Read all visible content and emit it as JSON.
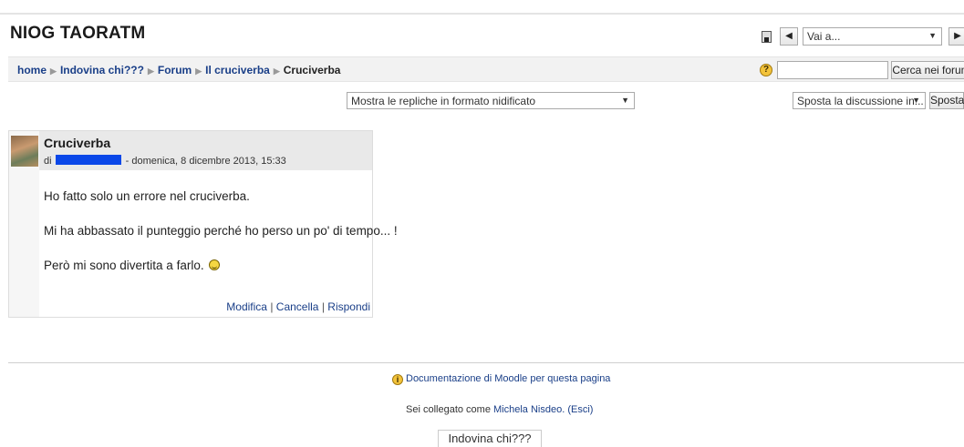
{
  "site": {
    "title": "NIOG TAORATM"
  },
  "header_nav": {
    "prev_label": "◀",
    "next_label": "▶",
    "jump_select_value": "Vai a...",
    "jump_arrow": "▼"
  },
  "breadcrumb": {
    "items": [
      "home",
      "Indovina chi???",
      "Forum",
      "Il cruciverba",
      "Cruciverba"
    ],
    "separator": "▶"
  },
  "search": {
    "help_label": "?",
    "placeholder": "",
    "button_label": "Cerca nei forum"
  },
  "discussion_controls": {
    "display_mode_value": "Mostra le repliche in formato nidificato",
    "move_select_value": "Sposta la discussione in...",
    "move_button_label": "Sposta"
  },
  "post": {
    "subject": "Cruciverba",
    "by_prefix": "di",
    "date": "- domenica, 8 dicembre 2013, 15:33",
    "paragraphs": [
      "Ho fatto solo un errore nel cruciverba.",
      "Mi ha abbassato il punteggio perché ho perso un po' di tempo... !",
      "Però mi sono divertita a farlo."
    ],
    "actions": {
      "edit": "Modifica",
      "delete": "Cancella",
      "reply": "Rispondi",
      "separator": "|"
    }
  },
  "footer": {
    "doc_link": "Documentazione di Moodle per questa pagina",
    "doc_icon": "i",
    "logged_in_prefix": "Sei collegato come",
    "user_name": "Michela Nisdeo.",
    "logout": "(Esci)",
    "home_link": "Indovina chi???"
  }
}
